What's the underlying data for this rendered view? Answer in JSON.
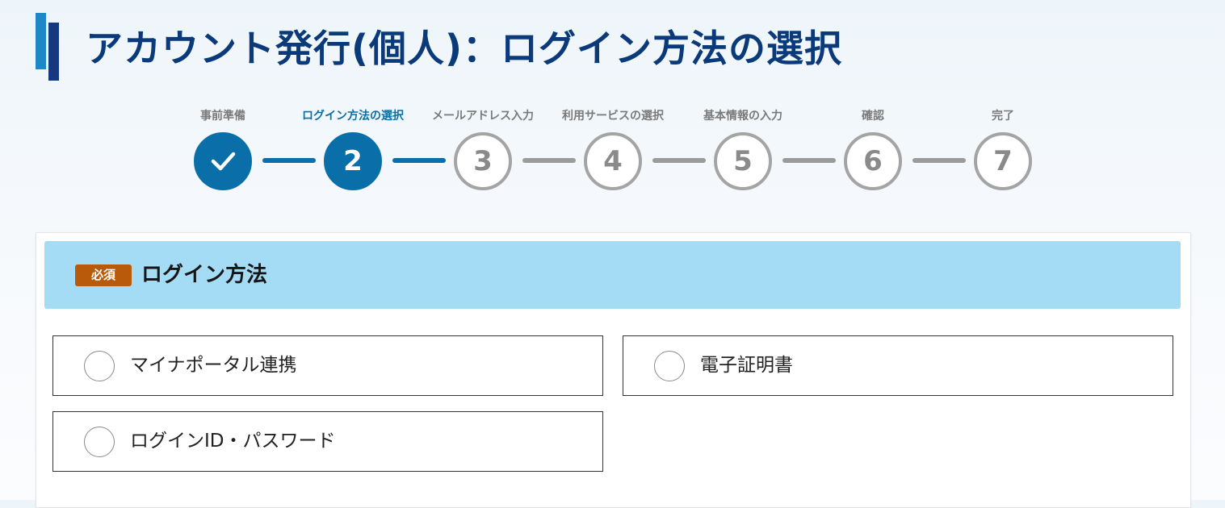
{
  "page": {
    "title": "アカウント発行(個人)：ログイン方法の選択"
  },
  "colors": {
    "primary": "#0a6fa8",
    "title_text": "#0b3a7a",
    "inactive_gray": "#a4a4a4",
    "section_header_bg": "#a4dbf5",
    "required_badge_bg": "#b95a0b"
  },
  "stepper": {
    "current_step": 2,
    "steps": [
      {
        "label": "事前準備",
        "marker": "",
        "state": "done"
      },
      {
        "label": "ログイン方法の選択",
        "marker": "2",
        "state": "active"
      },
      {
        "label": "メールアドレス入力",
        "marker": "3",
        "state": "pending"
      },
      {
        "label": "利用サービスの選択",
        "marker": "4",
        "state": "pending"
      },
      {
        "label": "基本情報の入力",
        "marker": "5",
        "state": "pending"
      },
      {
        "label": "確認",
        "marker": "6",
        "state": "pending"
      },
      {
        "label": "完了",
        "marker": "7",
        "state": "pending"
      }
    ],
    "done_icon": "checkmark-icon"
  },
  "section": {
    "required_label": "必須",
    "title": "ログイン方法"
  },
  "login_options": [
    {
      "label": "マイナポータル連携",
      "selected": false
    },
    {
      "label": "電子証明書",
      "selected": false
    },
    {
      "label": "ログインID・パスワード",
      "selected": false
    }
  ]
}
